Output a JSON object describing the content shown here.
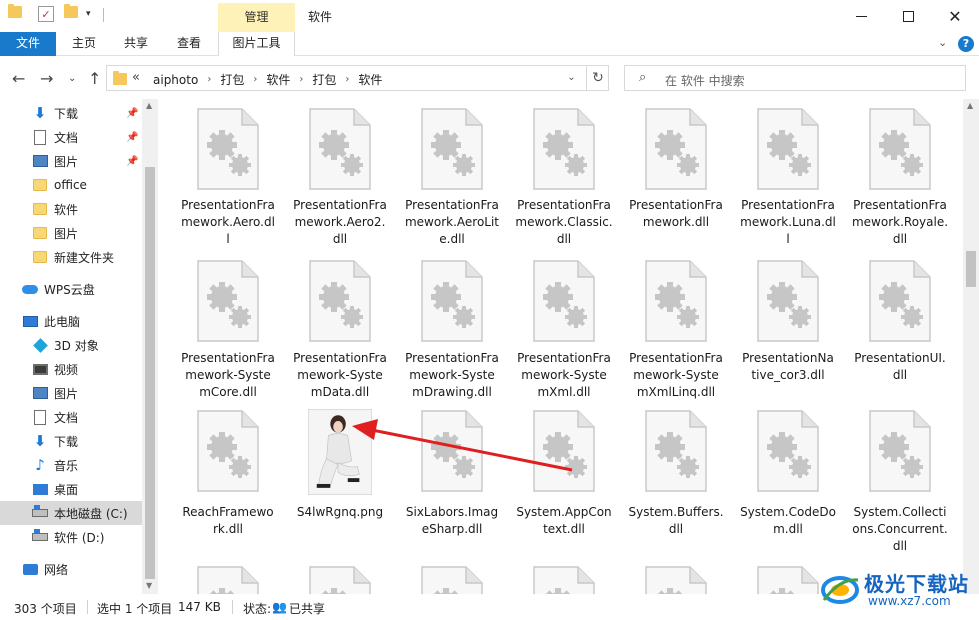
{
  "window": {
    "title": "软件",
    "context_tab_header": "管理",
    "min_glyph": "",
    "close_glyph": "✕"
  },
  "ribbon": {
    "tabs": [
      "文件",
      "主页",
      "共享",
      "查看",
      "图片工具"
    ],
    "chevron": "⌄",
    "help": "?"
  },
  "nav": {
    "back": "←",
    "forward": "→",
    "recent": "⌄",
    "up": "↑",
    "overflow": "«",
    "crumbs": [
      "aiphoto",
      "打包",
      "软件",
      "打包",
      "软件"
    ],
    "crumb_sep": "›",
    "dropdown": "⌄",
    "refresh": "↻"
  },
  "search": {
    "placeholder": "在 软件 中搜索",
    "icon": "⌕"
  },
  "sidebar": {
    "pin": "📌",
    "items": [
      {
        "label": "下载",
        "icon": "download-icon",
        "pinned": true
      },
      {
        "label": "文档",
        "icon": "document-icon",
        "pinned": true
      },
      {
        "label": "图片",
        "icon": "pictures-icon",
        "pinned": true
      },
      {
        "label": "office",
        "icon": "folder-icon"
      },
      {
        "label": "软件",
        "icon": "folder-icon"
      },
      {
        "label": "图片",
        "icon": "folder-icon"
      },
      {
        "label": "新建文件夹",
        "icon": "folder-icon"
      },
      {
        "label": "WPS云盘",
        "icon": "cloud-icon"
      },
      {
        "label": "此电脑",
        "icon": "computer-icon"
      },
      {
        "label": "3D 对象",
        "icon": "3d-objects-icon"
      },
      {
        "label": "视频",
        "icon": "video-icon"
      },
      {
        "label": "图片",
        "icon": "pictures-icon"
      },
      {
        "label": "文档",
        "icon": "document-icon"
      },
      {
        "label": "下载",
        "icon": "download-icon"
      },
      {
        "label": "音乐",
        "icon": "music-icon"
      },
      {
        "label": "桌面",
        "icon": "desktop-icon"
      },
      {
        "label": "本地磁盘 (C:)",
        "icon": "drive-icon",
        "selected": true
      },
      {
        "label": "软件 (D:)",
        "icon": "drive-icon"
      },
      {
        "label": "网络",
        "icon": "network-icon"
      }
    ]
  },
  "files": [
    {
      "name": "PresentationFramework.Aero.dll",
      "type": "dll"
    },
    {
      "name": "PresentationFramework.Aero2.dll",
      "type": "dll"
    },
    {
      "name": "PresentationFramework.AeroLite.dll",
      "type": "dll"
    },
    {
      "name": "PresentationFramework.Classic.dll",
      "type": "dll"
    },
    {
      "name": "PresentationFramework.dll",
      "type": "dll"
    },
    {
      "name": "PresentationFramework.Luna.dll",
      "type": "dll"
    },
    {
      "name": "PresentationFramework.Royale.dll",
      "type": "dll"
    },
    {
      "name": "PresentationFramework-SystemCore.dll",
      "type": "dll"
    },
    {
      "name": "PresentationFramework-SystemData.dll",
      "type": "dll"
    },
    {
      "name": "PresentationFramework-SystemDrawing.dll",
      "type": "dll"
    },
    {
      "name": "PresentationFramework-SystemXml.dll",
      "type": "dll"
    },
    {
      "name": "PresentationFramework-SystemXmlLinq.dll",
      "type": "dll"
    },
    {
      "name": "PresentationNative_cor3.dll",
      "type": "dll"
    },
    {
      "name": "PresentationUI.dll",
      "type": "dll"
    },
    {
      "name": "ReachFramework.dll",
      "type": "dll"
    },
    {
      "name": "S4lwRgnq.png",
      "type": "png"
    },
    {
      "name": "SixLabors.ImageSharp.dll",
      "type": "dll"
    },
    {
      "name": "System.AppContext.dll",
      "type": "dll"
    },
    {
      "name": "System.Buffers.dll",
      "type": "dll"
    },
    {
      "name": "System.CodeDom.dll",
      "type": "dll"
    },
    {
      "name": "System.Collections.Concurrent.dll",
      "type": "dll"
    }
  ],
  "file_name_display": [
    "PresentationFra\nmework.Aero.dl\nl",
    "PresentationFra\nmework.Aero2.\ndll",
    "PresentationFra\nmework.AeroLit\ne.dll",
    "PresentationFra\nmework.Classic.\ndll",
    "PresentationFra\nmework.dll",
    "PresentationFra\nmework.Luna.dl\nl",
    "PresentationFra\nmework.Royale.\ndll",
    "PresentationFra\nmework-Syste\nmCore.dll",
    "PresentationFra\nmework-Syste\nmData.dll",
    "PresentationFra\nmework-Syste\nmDrawing.dll",
    "PresentationFra\nmework-Syste\nmXml.dll",
    "PresentationFra\nmework-Syste\nmXmlLinq.dll",
    "PresentationNa\ntive_cor3.dll",
    "PresentationUI.\ndll",
    "ReachFramewo\nrk.dll",
    "S4lwRgnq.png",
    "SixLabors.Imag\neSharp.dll",
    "System.AppCon\ntext.dll",
    "System.Buffers.\ndll",
    "System.CodeDo\nm.dll",
    "System.Collecti\nons.Concurrent.\ndll"
  ],
  "status": {
    "count": "303 个项目",
    "selection": "选中 1 个项目",
    "size": "147 KB",
    "state_label": "状态:",
    "share": "已共享"
  },
  "annotation": {
    "arrow_color": "#e02020"
  },
  "watermark": {
    "text": "极光下载站",
    "url": "www.xz7.com"
  },
  "colors": {
    "accent": "#1979ca",
    "context_tab": "#fff2b8",
    "selected_nav": "#d9d9d9"
  }
}
